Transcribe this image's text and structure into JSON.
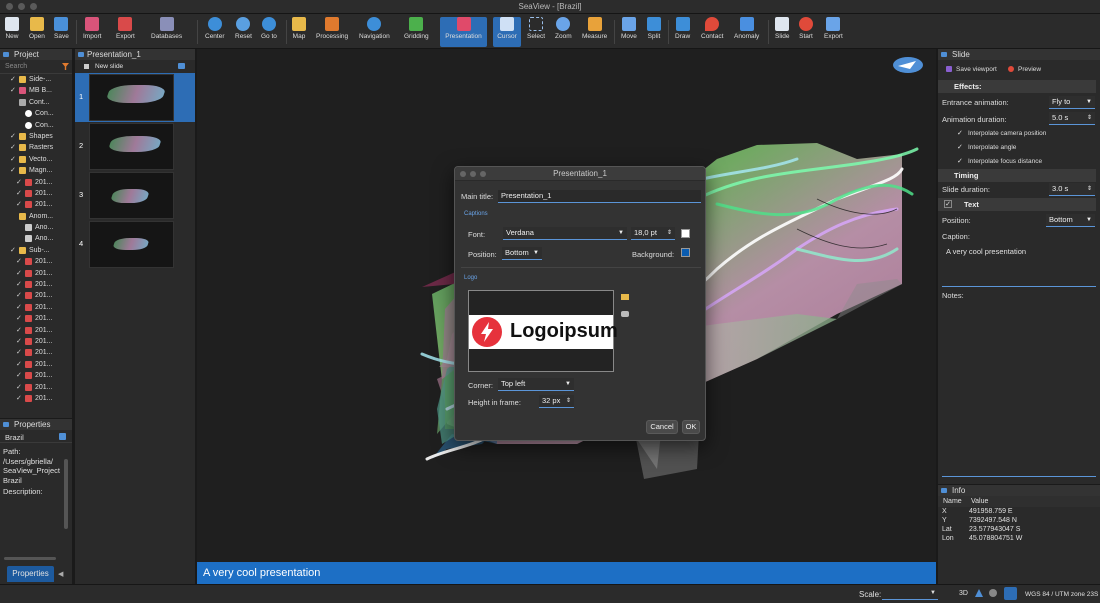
{
  "window": {
    "title": "SeaView - [Brazil]"
  },
  "toolbar": {
    "new": "New",
    "open": "Open",
    "save": "Save",
    "import": "Import",
    "export": "Export",
    "databases": "Databases",
    "center": "Center",
    "reset": "Reset",
    "goto": "Go to",
    "map": "Map",
    "processing": "Processing",
    "navigation": "Navigation",
    "gridding": "Gridding",
    "presentation": "Presentation",
    "cursor": "Cursor",
    "select": "Select",
    "zoom": "Zoom",
    "measure": "Measure",
    "move": "Move",
    "split": "Split",
    "draw": "Draw",
    "contact": "Contact",
    "anomaly": "Anomaly",
    "slide": "Slide",
    "start": "Start",
    "export2": "Export"
  },
  "project": {
    "header": "Project",
    "search_placeholder": "Search",
    "items": [
      "Side-...",
      "MB B...",
      "Cont...",
      "Con...",
      "Con...",
      "Shapes",
      "Rasters",
      "Vecto...",
      "Magn...",
      "201...",
      "201...",
      "201...",
      "Anom...",
      "Ano...",
      "Ano...",
      "Sub-...",
      "201...",
      "201...",
      "201...",
      "201...",
      "201...",
      "201...",
      "201...",
      "201...",
      "201...",
      "201...",
      "201...",
      "201...",
      "201..."
    ]
  },
  "properties": {
    "header": "Properties",
    "name": "Brazil",
    "path_label": "Path:",
    "path_value": "/Users/gbriella/ SeaView_Project Brazil",
    "description_label": "Description:",
    "tab": "Properties"
  },
  "presentation": {
    "tab": "Presentation_1",
    "new_slide": "New slide",
    "slides": [
      "1",
      "2",
      "3",
      "4"
    ]
  },
  "caption": "A very cool presentation",
  "dialog": {
    "title": "Presentation_1",
    "main_title_label": "Main title:",
    "main_title_value": "Presentation_1",
    "captions_section": "Captions",
    "font_label": "Font:",
    "font_value": "Verdana",
    "font_size": "18,0 pt",
    "position_label": "Position:",
    "position_value": "Bottom",
    "background_label": "Background:",
    "logo_section": "Logo",
    "logo_text": "Logoipsum",
    "corner_label": "Corner:",
    "corner_value": "Top left",
    "height_label": "Height in frame:",
    "height_value": "32 px",
    "cancel": "Cancel",
    "ok": "OK"
  },
  "slide_panel": {
    "header": "Slide",
    "save_viewport": "Save viewport",
    "preview": "Preview",
    "effects": "Effects:",
    "entrance_label": "Entrance animation:",
    "entrance_value": "Fly to",
    "duration_label": "Animation duration:",
    "duration_value": "5.0 s",
    "interp_camera": "Interpolate camera position",
    "interp_angle": "Interpolate angle",
    "interp_focus": "Interpolate focus distance",
    "timing": "Timing",
    "slide_duration_label": "Slide duration:",
    "slide_duration_value": "3.0 s",
    "text_section": "Text",
    "position_label": "Position:",
    "position_value": "Bottom",
    "caption_label": "Caption:",
    "caption_value": "A very cool presentation",
    "notes_label": "Notes:"
  },
  "info": {
    "header": "Info",
    "col_name": "Name",
    "col_value": "Value",
    "rows": [
      {
        "name": "X",
        "value": "491958.759 E"
      },
      {
        "name": "Y",
        "value": "7392497.548 N"
      },
      {
        "name": "Lat",
        "value": "23.577943047 S"
      },
      {
        "name": "Lon",
        "value": "45.078804751 W"
      }
    ]
  },
  "status": {
    "scale_label": "Scale:",
    "mode_3d": "3D",
    "crs": "WGS 84 / UTM zone 23S"
  },
  "colors": {
    "accent": "#1d6fc5",
    "caption_bg": "#1d6fc5",
    "dialog_bg_swatch": "#0a5cb0"
  }
}
